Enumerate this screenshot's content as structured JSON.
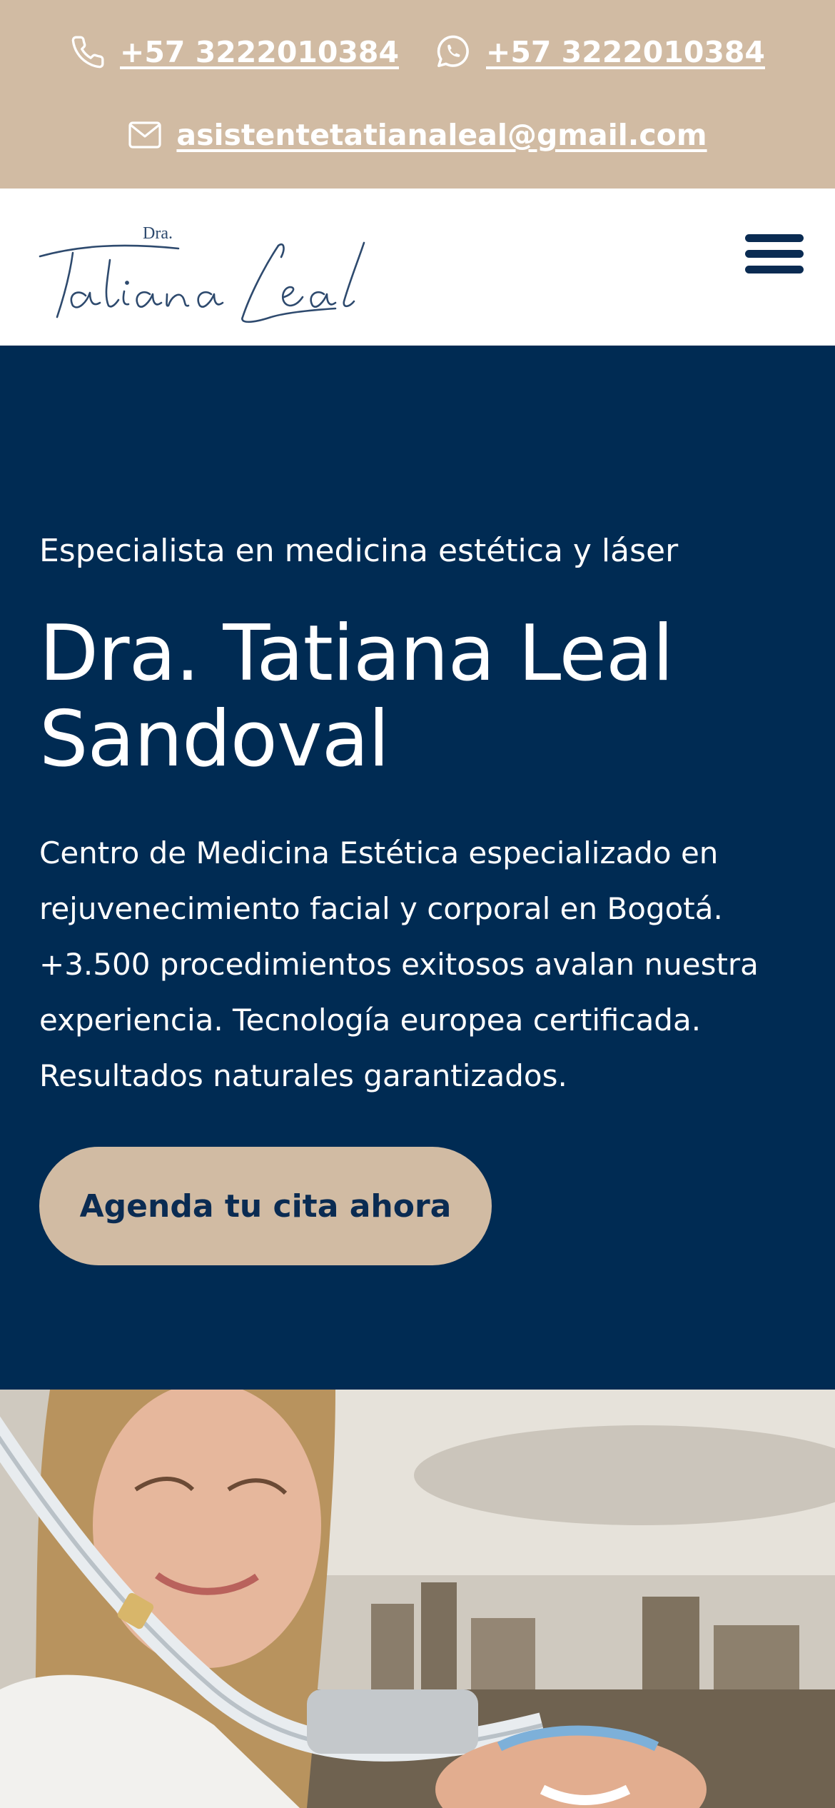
{
  "topbar": {
    "phone": {
      "icon": "phone-icon",
      "text": "+57 3222010384"
    },
    "whatsapp": {
      "icon": "whatsapp-icon",
      "text": "+57 3222010384"
    },
    "email": {
      "icon": "mail-icon",
      "text": "asistentetatianaleal@gmail.com"
    },
    "color": "#D1BBA3"
  },
  "header": {
    "logo_prefix": "Dra.",
    "logo_text": "TatianaLeal",
    "menu_icon": "hamburger-menu-icon"
  },
  "hero": {
    "eyebrow": "Especialista en medicina estética y láser",
    "title_line1": "Dra. Tatiana Leal",
    "title_line2": "Sandoval",
    "description": "Centro de Medicina Estética especializado en rejuvenecimiento facial y corporal en Bogotá. +3.500 procedimientos exitosos avalan nuestra experiencia. Tecnología europea certificada. Resultados naturales garantizados.",
    "cta_label": "Agenda tu cita ahora",
    "background": "#002B53",
    "accent": "#D1BBA3"
  }
}
